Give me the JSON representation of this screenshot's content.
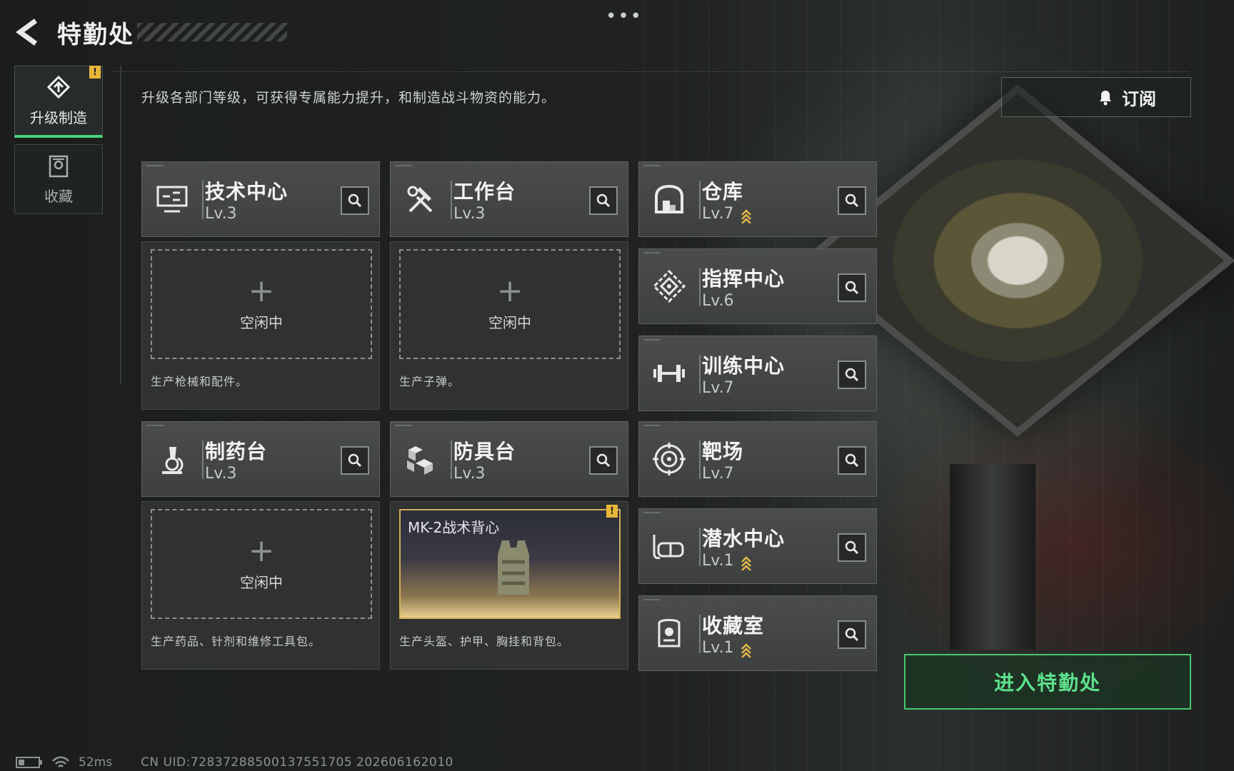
{
  "header": {
    "title": "特勤处"
  },
  "top_dots": "•••",
  "nav": {
    "items": [
      {
        "label": "升级制造",
        "active": true,
        "badge": "!"
      },
      {
        "label": "收藏",
        "active": false
      }
    ]
  },
  "subtitle": "升级各部门等级，可获得专属能力提升，和制造战斗物资的能力。",
  "subscribe": {
    "label": "订阅"
  },
  "facilities": {
    "tech": {
      "name": "技术中心",
      "level": "Lv.3"
    },
    "workbench": {
      "name": "工作台",
      "level": "Lv.3"
    },
    "pharmacy": {
      "name": "制药台",
      "level": "Lv.3"
    },
    "armor": {
      "name": "防具台",
      "level": "Lv.3"
    },
    "warehouse": {
      "name": "仓库",
      "level": "Lv.7",
      "upgradable": true
    },
    "command": {
      "name": "指挥中心",
      "level": "Lv.6"
    },
    "training": {
      "name": "训练中心",
      "level": "Lv.7"
    },
    "range": {
      "name": "靶场",
      "level": "Lv.7"
    },
    "diving": {
      "name": "潜水中心",
      "level": "Lv.1",
      "upgradable": true
    },
    "collection": {
      "name": "收藏室",
      "level": "Lv.1",
      "upgradable": true
    }
  },
  "production": {
    "tech": {
      "slot": "空闲中",
      "desc": "生产枪械和配件。"
    },
    "workbench": {
      "slot": "空闲中",
      "desc": "生产子弹。"
    },
    "pharmacy": {
      "slot": "空闲中",
      "desc": "生产药品、针剂和维修工具包。"
    },
    "armor": {
      "item": "MK-2战术背心",
      "badge": "!",
      "desc": "生产头盔、护甲、胸挂和背包。"
    }
  },
  "enter_button": {
    "label": "进入特勤处"
  },
  "status_bar": {
    "ping": "52ms",
    "uid": "CN UID:7283728850013755170​5 202606162010"
  },
  "colors": {
    "accent_green": "#49d17a",
    "badge_yellow": "#e8b73a",
    "item_gold": "#d2ac5a"
  }
}
